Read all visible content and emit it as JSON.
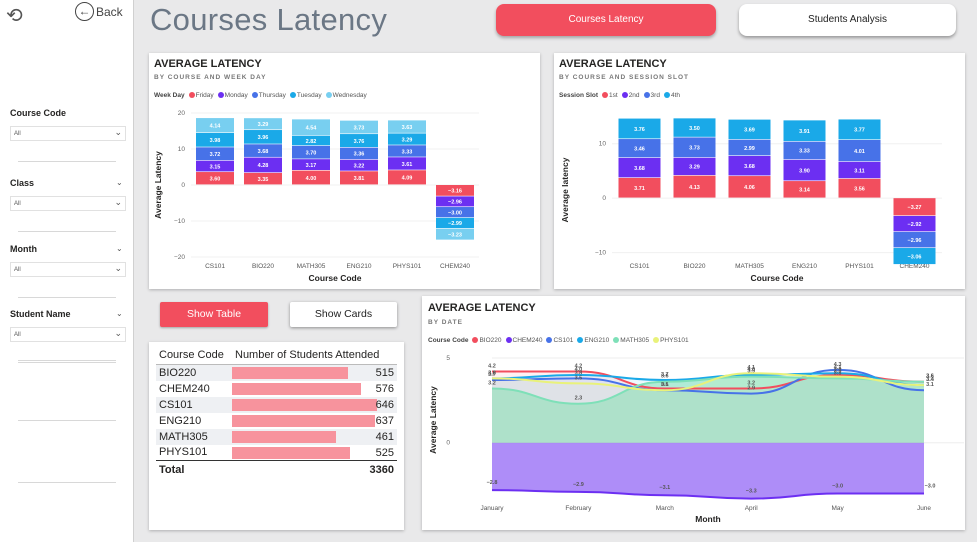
{
  "nav": {
    "back_label": "Back",
    "title": "Courses Latency",
    "tab_active": "Courses Latency",
    "tab_other": "Students Analysis"
  },
  "colors": {
    "accent": "#f24e5e",
    "Friday": "#f24e5e",
    "Monday": "#6c2ff2",
    "Thursday": "#4772e8",
    "Tuesday": "#1aa9e8",
    "Wednesday": "#78cff0",
    "1st": "#f24e5e",
    "2nd": "#6c2ff2",
    "3rd": "#4772e8",
    "4th": "#1aa9e8",
    "BIO220": "#f24e5e",
    "CHEM240": "#6c2ff2",
    "CS101": "#4772e8",
    "ENG210": "#1aa9e8",
    "MATH305": "#7ee0b8",
    "PHYS101": "#e9f27a"
  },
  "filters": [
    {
      "label": "Course Code",
      "value": "All"
    },
    {
      "label": "Class",
      "value": "All"
    },
    {
      "label": "Month",
      "value": "All"
    },
    {
      "label": "Student Name",
      "value": "All"
    }
  ],
  "chart1": {
    "title": "AVERAGE LATENCY",
    "subtitle": "BY COURSE AND WEEK DAY",
    "legend_title": "Week Day"
  },
  "chart2": {
    "title": "AVERAGE LATENCY",
    "subtitle": "BY COURSE AND SESSION SLOT",
    "legend_title": "Session Slot"
  },
  "chart3": {
    "title": "AVERAGE LATENCY",
    "subtitle": "BY DATE",
    "legend_title": "Course Code"
  },
  "toggle": {
    "show_table": "Show Table",
    "show_cards": "Show Cards"
  },
  "table": {
    "headers": [
      "Course Code",
      "Number of Students Attended"
    ],
    "rows": [
      {
        "course": "BIO220",
        "count": 515
      },
      {
        "course": "CHEM240",
        "count": 576
      },
      {
        "course": "CS101",
        "count": 646
      },
      {
        "course": "ENG210",
        "count": 637
      },
      {
        "course": "MATH305",
        "count": 461
      },
      {
        "course": "PHYS101",
        "count": 525
      }
    ],
    "total_label": "Total",
    "total_value": "3360"
  },
  "chart_data": [
    {
      "type": "bar",
      "stacked": true,
      "title": "AVERAGE LATENCY",
      "subtitle": "BY COURSE AND WEEK DAY",
      "xlabel": "Course Code",
      "ylabel": "Average Latency",
      "ylim": [
        -20,
        20
      ],
      "yticks": [
        20,
        10,
        0,
        -10,
        -20
      ],
      "legend_title": "Week Day",
      "categories": [
        "CS101",
        "BIO220",
        "MATH305",
        "ENG210",
        "PHYS101",
        "CHEM240"
      ],
      "series": [
        {
          "name": "Friday",
          "values": [
            3.6,
            3.35,
            4.0,
            3.81,
            4.09,
            null
          ]
        },
        {
          "name": "Monday",
          "values": [
            3.15,
            4.28,
            3.17,
            3.22,
            3.61,
            -2.96
          ]
        },
        {
          "name": "Thursday",
          "values": [
            3.72,
            3.68,
            3.7,
            3.36,
            3.33,
            -3.0
          ]
        },
        {
          "name": "Tuesday",
          "values": [
            3.98,
            3.96,
            2.82,
            3.76,
            3.29,
            -2.99
          ]
        },
        {
          "name": "Wednesday",
          "values": [
            4.14,
            3.29,
            4.54,
            3.73,
            3.63,
            -3.23
          ]
        }
      ],
      "negative_first_segment": {
        "category": "CHEM240",
        "series": "Friday",
        "value": -3.16
      }
    },
    {
      "type": "bar",
      "stacked": true,
      "title": "AVERAGE LATENCY",
      "subtitle": "BY COURSE AND SESSION SLOT",
      "xlabel": "Course Code",
      "ylabel": "Average latency",
      "ylim": [
        -13,
        16
      ],
      "yticks": [
        10,
        0,
        -10
      ],
      "legend_title": "Session Slot",
      "categories": [
        "CS101",
        "BIO220",
        "MATH305",
        "ENG210",
        "PHYS101",
        "CHEM240"
      ],
      "series": [
        {
          "name": "1st",
          "values": [
            3.71,
            4.13,
            4.06,
            3.14,
            3.56,
            -3.27
          ]
        },
        {
          "name": "2nd",
          "values": [
            3.68,
            3.29,
            3.68,
            3.9,
            3.11,
            -2.92
          ]
        },
        {
          "name": "3rd",
          "values": [
            3.46,
            3.73,
            2.99,
            3.33,
            4.01,
            -2.96
          ]
        },
        {
          "name": "4th",
          "values": [
            3.76,
            3.5,
            3.69,
            3.91,
            3.77,
            -3.06
          ]
        }
      ]
    },
    {
      "type": "area",
      "title": "AVERAGE LATENCY",
      "subtitle": "BY DATE",
      "xlabel": "Month",
      "ylabel": "Average Latency",
      "ylim": [
        -3.5,
        5
      ],
      "yticks": [
        5,
        0
      ],
      "legend_title": "Course Code",
      "x": [
        "January",
        "February",
        "March",
        "April",
        "May",
        "June"
      ],
      "series": [
        {
          "name": "BIO220",
          "values": [
            4.2,
            4.2,
            3.2,
            3.2,
            4.0,
            3.6
          ]
        },
        {
          "name": "CHEM240",
          "values": [
            -2.8,
            -2.9,
            -3.1,
            -3.3,
            -3.0,
            -3.0
          ]
        },
        {
          "name": "CS101",
          "values": [
            3.7,
            3.8,
            3.1,
            2.9,
            4.3,
            3.1
          ]
        },
        {
          "name": "ENG210",
          "values": [
            3.8,
            4.0,
            3.7,
            4.0,
            4.1,
            3.4
          ]
        },
        {
          "name": "MATH305",
          "values": [
            3.2,
            2.3,
            3.6,
            3.9,
            3.8,
            3.6
          ]
        },
        {
          "name": "PHYS101",
          "values": [
            3.8,
            3.5,
            3.1,
            4.1,
            3.9,
            3.4
          ]
        }
      ]
    }
  ]
}
